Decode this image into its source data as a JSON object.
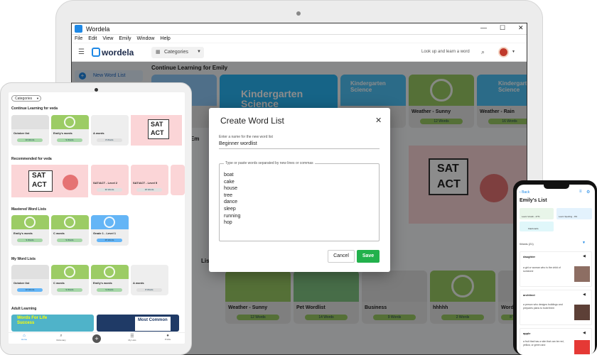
{
  "app": {
    "window_title": "Wordela",
    "menu": [
      "File",
      "Edit",
      "View",
      "Emily",
      "Window",
      "Help"
    ],
    "logo_text": "wordela",
    "categories_label": "Categories",
    "search_placeholder": "Look up and learn a word",
    "new_word_list": "New Word List"
  },
  "laptop": {
    "continue_title": "Continue Learning for Emily",
    "for_prefix": "for Em",
    "lists_suffix": "Lists",
    "cards_top": [
      {
        "title": "Kindergarten Science",
        "label": "",
        "count": ""
      },
      {
        "title": "Kindergarten Science",
        "label": "",
        "count": ""
      },
      {
        "title": "",
        "label": "Weather - Sunny",
        "count": "12 Words"
      },
      {
        "title": "Kindergarten Science",
        "label": "Weather - Rain",
        "count": "16 Words"
      }
    ],
    "cards_bottom": [
      {
        "label": "ds1",
        "count": ""
      },
      {
        "label": "Weather - Sunny",
        "count": "12 Words"
      },
      {
        "label": "Pet Wordlist",
        "count": "14 Words"
      },
      {
        "label": "Business",
        "count": "9 Words"
      },
      {
        "label": "hhhhh",
        "count": "2 Words"
      },
      {
        "label": "Word c",
        "count": "8 Wo"
      }
    ],
    "sat_text": "SAT",
    "act_text": "ACT"
  },
  "modal": {
    "title": "Create Word List",
    "name_label": "Enter a name for the new word list",
    "name_value": "Beginner wordlist",
    "words_label": "Type or paste words separated by new lines or commas",
    "words": [
      "boat",
      "cake",
      "house",
      "tree",
      "dance",
      "sleep",
      "running",
      "hop"
    ],
    "cancel": "Cancel",
    "save": "Save"
  },
  "tablet": {
    "categories": "Categories",
    "continue_title": "Continue Learning for veda",
    "continue_cards": [
      {
        "label": "October list",
        "count": "10 Words"
      },
      {
        "label": "Emily's words",
        "count": "9 Words"
      },
      {
        "label": "A words",
        "count": "8 Words"
      }
    ],
    "recommended_title": "Recommended for veda",
    "recommended_cards": [
      {
        "label": "SAT/ACT - Level 2",
        "count": "30 Words"
      },
      {
        "label": "SAT/ACT - Level 5",
        "count": "18 Words"
      },
      {
        "label": "SAT/ACT - Level 4",
        "count": "14 Words"
      }
    ],
    "mastered_title": "Mastered Word Lists",
    "mastered_cards": [
      {
        "label": "Emily's words",
        "count": "9 Words"
      },
      {
        "label": "C words",
        "count": "9 Words"
      },
      {
        "label": "Grade 1 - Level 1",
        "count": "25 Words"
      }
    ],
    "my_title": "My Word Lists",
    "my_cards": [
      {
        "label": "October list",
        "count": "10 Words"
      },
      {
        "label": "C words",
        "count": "9 Words"
      },
      {
        "label": "Emily's words",
        "count": "9 Words"
      },
      {
        "label": "A words",
        "count": "8 Words"
      }
    ],
    "adult_title": "Adult Learning",
    "adult_card1": "Words For Life Success",
    "adult_card2": "Most Common",
    "nav": [
      "Home",
      "Dictionary",
      "",
      "My Lists",
      "Profile"
    ]
  },
  "phone": {
    "back": "Back",
    "title": "Emily's List",
    "chip1": "Learn Vocab - 47%",
    "chip2": "Learn Spelling - 9%",
    "chip3": "Flashcards",
    "words_header": "Words (21)",
    "entries": [
      {
        "word": "daughter",
        "def": "a girl or woman who is the child of someone"
      },
      {
        "word": "architect",
        "def": "a person who designs buildings and prepares plans to build them"
      },
      {
        "word": "apple",
        "def": "a fruit that has a skin that can be red, yellow, or green and"
      }
    ]
  }
}
